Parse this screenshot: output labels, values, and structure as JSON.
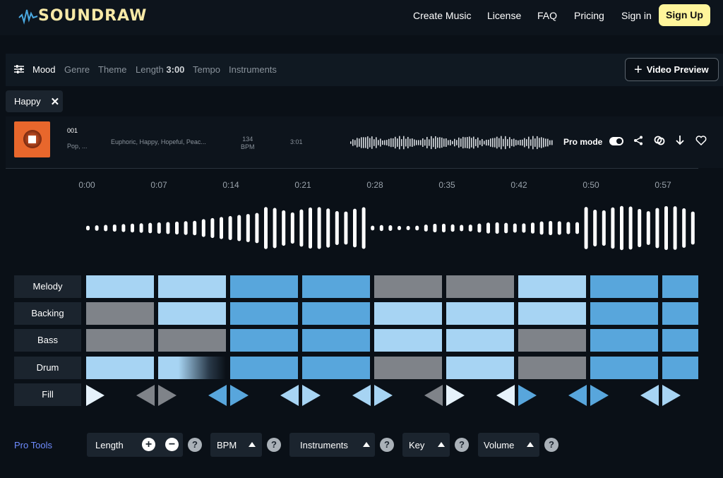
{
  "header": {
    "logo_text": "SOUNDRAW",
    "nav": [
      "Create Music",
      "License",
      "FAQ",
      "Pricing",
      "Sign in"
    ],
    "signup_label": "Sign Up"
  },
  "filters": {
    "items": [
      "Mood",
      "Genre",
      "Theme",
      "Length",
      "Tempo",
      "Instruments"
    ],
    "length_value": "3:00",
    "video_preview_label": "Video Preview"
  },
  "chip": {
    "label": "Happy"
  },
  "track": {
    "number": "001",
    "genre": "Pop, ...",
    "moods": "Euphoric, Happy, Hopeful, Peac...",
    "bpm_value": "134",
    "bpm_unit": "BPM",
    "duration": "3:01",
    "pro_mode_label": "Pro mode",
    "pro_mode_on": true
  },
  "timeline": [
    "0:00",
    "0:07",
    "0:14",
    "0:21",
    "0:28",
    "0:35",
    "0:42",
    "0:50",
    "0:57"
  ],
  "rows": [
    {
      "label": "Melody",
      "levels": [
        1,
        1,
        2,
        2,
        0,
        0,
        1,
        2,
        2
      ]
    },
    {
      "label": "Backing",
      "levels": [
        0,
        1,
        2,
        2,
        1,
        1,
        1,
        2,
        2
      ]
    },
    {
      "label": "Bass",
      "levels": [
        0,
        0,
        2,
        2,
        1,
        1,
        0,
        2,
        2
      ]
    },
    {
      "label": "Drum",
      "levels": [
        1,
        3,
        2,
        2,
        0,
        1,
        0,
        2,
        2
      ]
    }
  ],
  "fill": {
    "label": "Fill",
    "arrows": [
      {
        "dir": "right",
        "level": 4
      },
      {
        "dir": "left",
        "level": 0
      },
      {
        "dir": "right",
        "level": 0
      },
      {
        "dir": "left",
        "level": 2
      },
      {
        "dir": "right",
        "level": 2
      },
      {
        "dir": "left",
        "level": 1
      },
      {
        "dir": "right",
        "level": 1
      },
      {
        "dir": "left",
        "level": 1
      },
      {
        "dir": "right",
        "level": 1
      },
      {
        "dir": "left",
        "level": 0
      },
      {
        "dir": "right",
        "level": 4
      },
      {
        "dir": "left",
        "level": 4
      },
      {
        "dir": "right",
        "level": 2
      },
      {
        "dir": "left",
        "level": 2
      },
      {
        "dir": "right",
        "level": 2
      },
      {
        "dir": "left",
        "level": 1
      },
      {
        "dir": "right",
        "level": 1
      }
    ]
  },
  "colors": {
    "level_0": "#7f8389",
    "level_1": "#a7d4f3",
    "level_2": "#58a6dc",
    "level_4": "#e6f2fb",
    "accent": "#fff59b",
    "pro_tools": "#6f8cff"
  },
  "pro_tools": {
    "label": "Pro Tools",
    "length": "Length",
    "bpm": "BPM",
    "instruments": "Instruments",
    "key": "Key",
    "volume": "Volume",
    "help": "?"
  }
}
